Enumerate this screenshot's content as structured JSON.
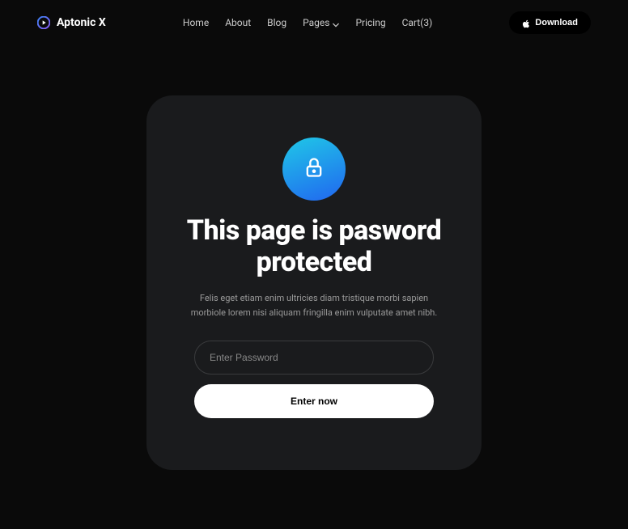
{
  "header": {
    "brand": "Aptonic X",
    "nav": {
      "home": "Home",
      "about": "About",
      "blog": "Blog",
      "pages": "Pages",
      "pricing": "Pricing",
      "cart": "Cart(3)"
    },
    "download_label": "Download"
  },
  "card": {
    "title": "This page is pasword protected",
    "subtitle": "Felis eget etiam enim ultricies diam tristique morbi sapien morbiole lorem nisi aliquam fringilla enim vulputate amet nibh.",
    "password_placeholder": "Enter Password",
    "submit_label": "Enter now"
  }
}
